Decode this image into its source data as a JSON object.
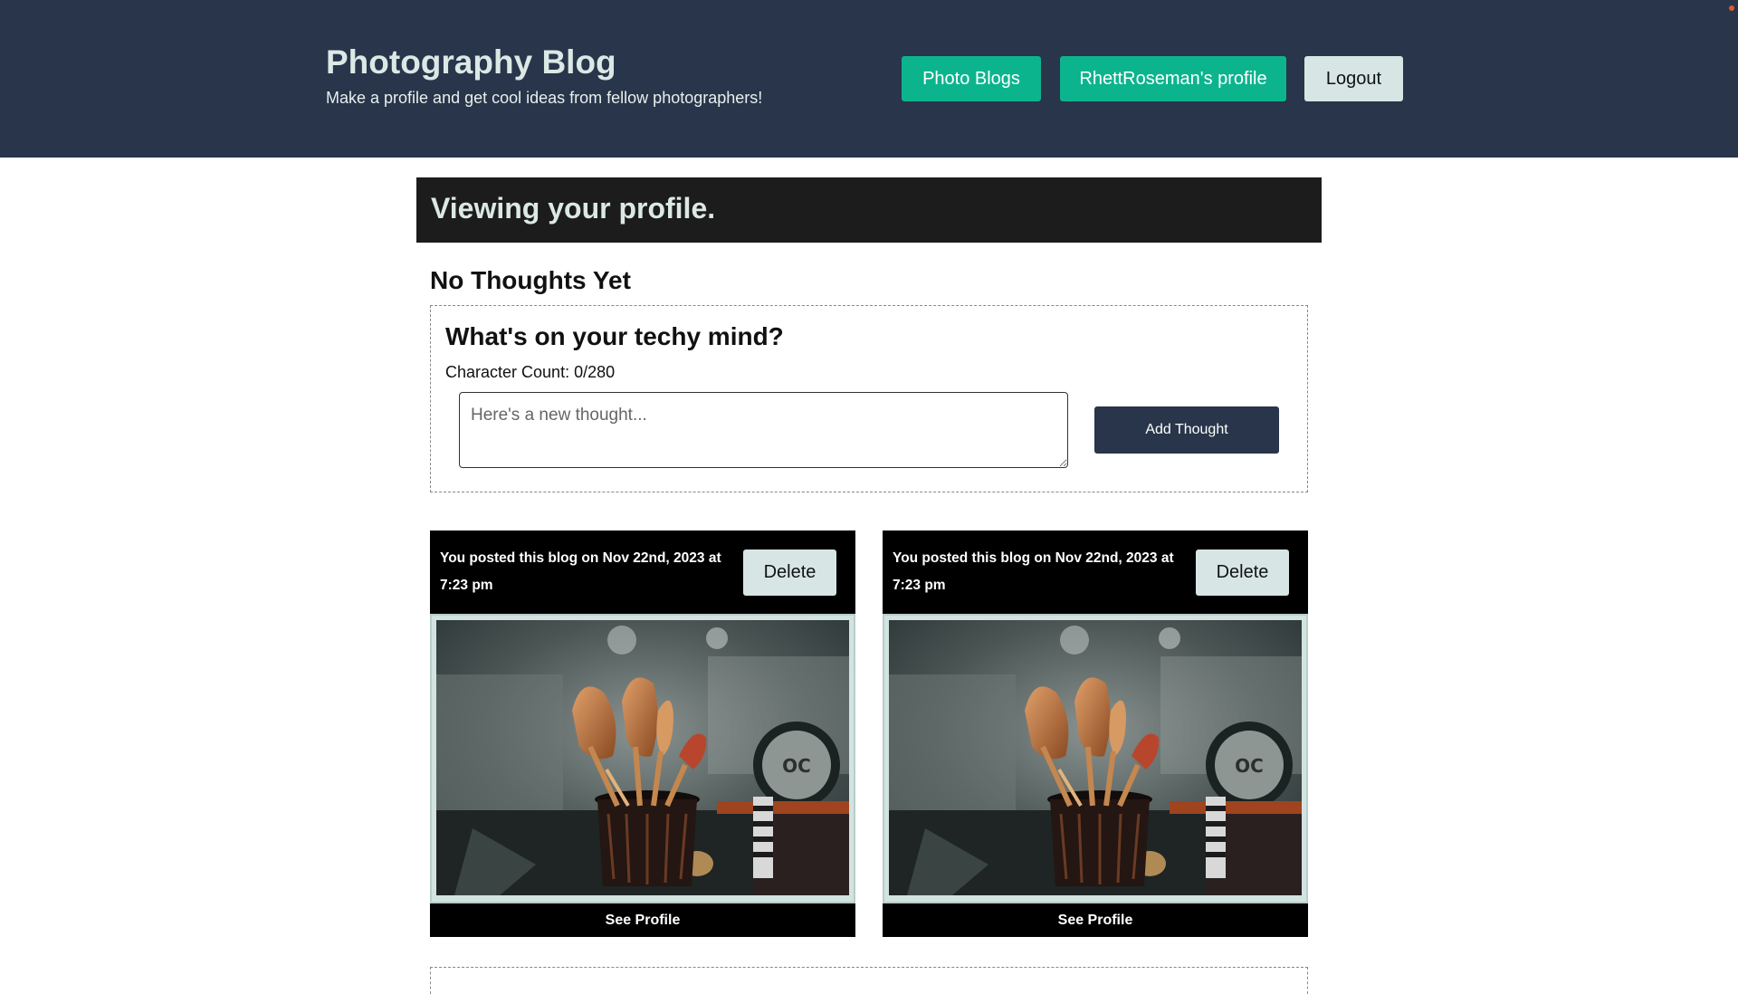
{
  "header": {
    "title": "Photography Blog",
    "tagline": "Make a profile and get cool ideas from fellow photographers!",
    "nav": {
      "photo_blogs": "Photo Blogs",
      "profile": "RhettRoseman's profile",
      "logout": "Logout"
    }
  },
  "banner": {
    "text": "Viewing your profile."
  },
  "thoughts": {
    "empty_heading": "No Thoughts Yet",
    "form_title": "What's on your techy mind?",
    "char_count": "Character Count: 0/280",
    "placeholder": "Here's a new thought...",
    "value": "",
    "submit_label": "Add Thought"
  },
  "blogs": [
    {
      "meta": "You posted this blog on Nov 22nd, 2023 at 7:23 pm",
      "delete_label": "Delete",
      "image_icon": "makeup-brushes-photo",
      "see_profile": "See Profile"
    },
    {
      "meta": "You posted this blog on Nov 22nd, 2023 at 7:23 pm",
      "delete_label": "Delete",
      "image_icon": "makeup-brushes-photo",
      "see_profile": "See Profile"
    }
  ],
  "colors": {
    "header_bg": "#28354a",
    "accent": "#0cb48e",
    "light_button": "#d7e6e4",
    "banner_bg": "#1c1c1c"
  }
}
